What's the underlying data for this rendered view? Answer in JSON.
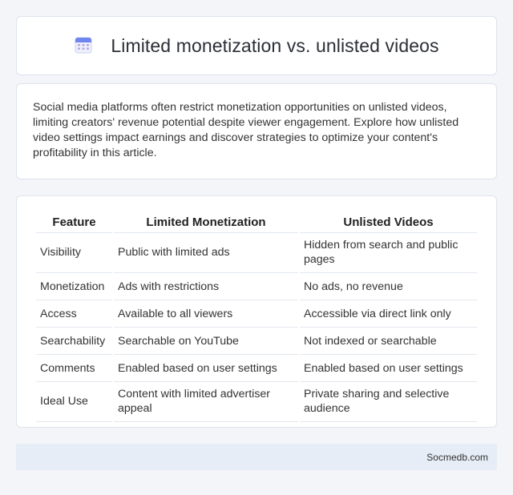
{
  "title": "Limited monetization vs. unlisted videos",
  "intro": "Social media platforms often restrict monetization opportunities on unlisted videos, limiting creators' revenue potential despite viewer engagement. Explore how unlisted video settings impact earnings and discover strategies to optimize your content's profitability in this article.",
  "table": {
    "headers": [
      "Feature",
      "Limited Monetization",
      "Unlisted Videos"
    ],
    "rows": [
      [
        "Visibility",
        "Public with limited ads",
        "Hidden from search and public pages"
      ],
      [
        "Monetization",
        "Ads with restrictions",
        "No ads, no revenue"
      ],
      [
        "Access",
        "Available to all viewers",
        "Accessible via direct link only"
      ],
      [
        "Searchability",
        "Searchable on YouTube",
        "Not indexed or searchable"
      ],
      [
        "Comments",
        "Enabled based on user settings",
        "Enabled based on user settings"
      ],
      [
        "Ideal Use",
        "Content with limited advertiser appeal",
        "Private sharing and selective audience"
      ]
    ]
  },
  "footer": "Socmedb.com",
  "colors": {
    "background": "#f3f5f9",
    "footer_bg": "#e7edf6",
    "icon_accent": "#7a8cf0"
  },
  "icons": [
    "calendar-icon"
  ]
}
